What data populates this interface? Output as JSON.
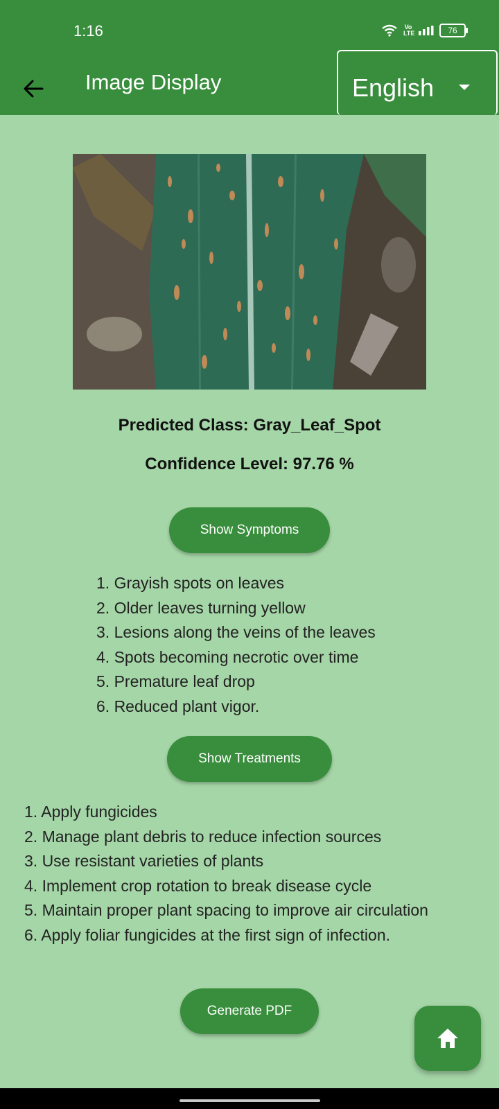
{
  "status_bar": {
    "time": "1:16",
    "network_label": "Vo LTE",
    "battery": "76",
    "icons": [
      "wifi-icon",
      "volte-icon",
      "signal-icon",
      "battery-icon"
    ]
  },
  "app_bar": {
    "title": "Image Display",
    "back_icon": "arrow-left-icon",
    "language": "English"
  },
  "result": {
    "predicted_class": "Predicted Class: Gray_Leaf_Spot",
    "confidence": "Confidence Level: 97.76 %"
  },
  "symptoms": {
    "button_label": "Show Symptoms",
    "items": [
      "1. Grayish spots on leaves",
      "2. Older leaves turning yellow",
      "3. Lesions along the veins of the leaves",
      "4. Spots becoming necrotic over time",
      "5. Premature leaf drop",
      "6. Reduced plant vigor."
    ]
  },
  "treatments": {
    "button_label": "Show Treatments",
    "items": [
      "1. Apply fungicides",
      "2. Manage plant debris to reduce infection sources",
      "3. Use resistant varieties of plants",
      "4. Implement crop rotation to break disease cycle",
      "5. Maintain proper plant spacing to improve air circulation",
      "6. Apply foliar fungicides at the first sign of infection."
    ]
  },
  "actions": {
    "generate_pdf_label": "Generate PDF",
    "home_icon": "home-icon"
  },
  "colors": {
    "primary": "#388e3c",
    "background": "#a5d6a7",
    "text": "#111111"
  }
}
